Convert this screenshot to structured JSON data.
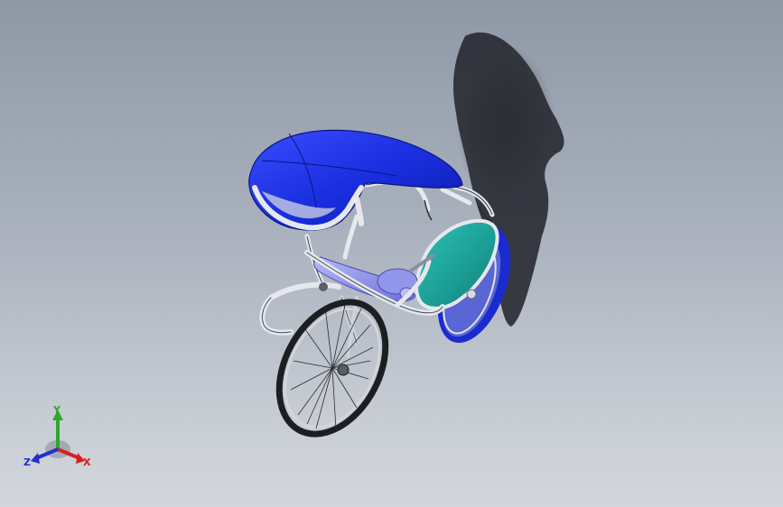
{
  "view": {
    "background_top": "#8e98a6",
    "background_bottom": "#d3d6dc"
  },
  "model": {
    "canopy_color": "#1a2fe0",
    "frame_color": "#e6e8ee",
    "side_panel_color": "#1aa8a0",
    "rear_wheel_color": "#1b2bd0",
    "seat_color": "#8a8ee8"
  },
  "triad": {
    "x_label": "X",
    "y_label": "Y",
    "z_label": "Z",
    "x_color": "#d62020",
    "y_color": "#2ea82e",
    "z_color": "#2030d0"
  }
}
